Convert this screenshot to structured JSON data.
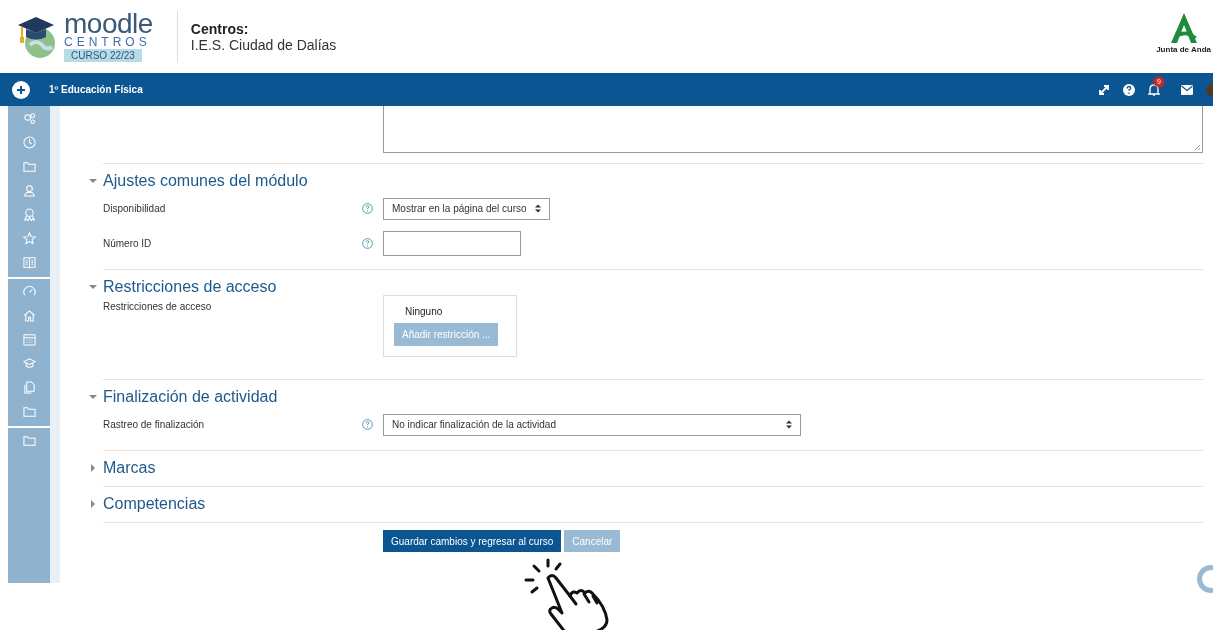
{
  "header": {
    "logo": {
      "word": "moodle",
      "sub": "CENTROS",
      "badge": "CURSO 22/23"
    },
    "center": {
      "label": "Centros:",
      "name": "I.E.S. Ciudad de Dalías"
    },
    "partner": {
      "name": "Junta de Anda"
    }
  },
  "navbar": {
    "course": "1º Educación Física",
    "notifications": "9"
  },
  "sections": [
    {
      "title": "Ajustes comunes del módulo",
      "expanded": true,
      "fields": [
        {
          "kind": "select",
          "label": "Disponibilidad",
          "help": true,
          "value": "Mostrar en la página del curso"
        },
        {
          "kind": "text",
          "label": "Número ID",
          "help": true
        }
      ]
    },
    {
      "title": "Restricciones de acceso",
      "expanded": true,
      "fields": [
        {
          "kind": "restrictions",
          "label": "Restricciones de acceso",
          "help": false,
          "value": "Ninguno",
          "button": "Añadir restricción ..."
        }
      ]
    },
    {
      "title": "Finalización de actividad",
      "expanded": true,
      "fields": [
        {
          "kind": "wide-select",
          "label": "Rastreo de finalización",
          "help": true,
          "value": "No indicar finalización de la actividad"
        }
      ]
    },
    {
      "title": "Marcas",
      "expanded": false
    },
    {
      "title": "Competencias",
      "expanded": false
    }
  ],
  "buttons": [
    {
      "kind": "primary",
      "label": "Guardar cambios y regresar al curso"
    },
    {
      "kind": "secondary",
      "label": "Cancelar"
    }
  ]
}
